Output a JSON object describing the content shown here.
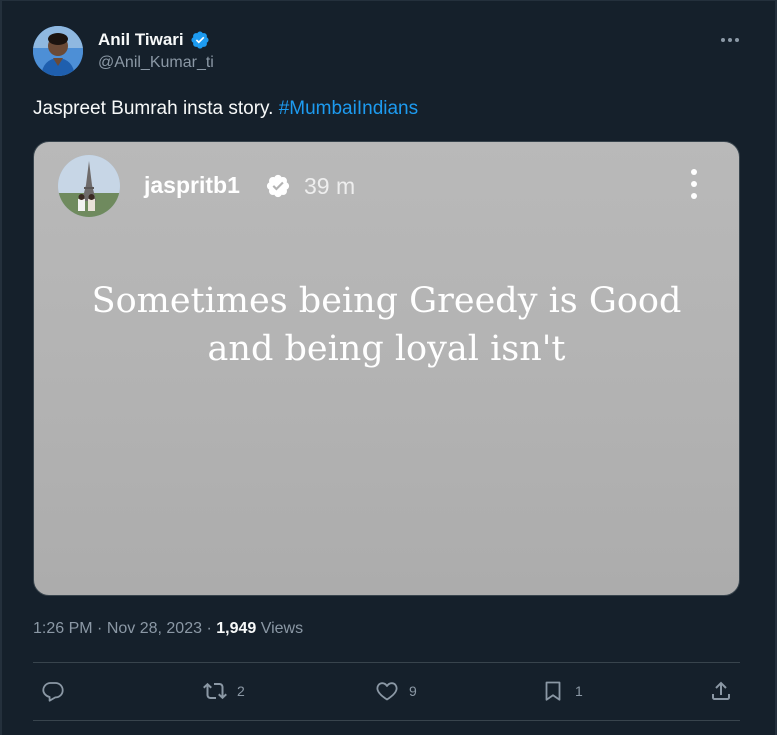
{
  "tweet": {
    "author_name": "Anil Tiwari",
    "author_handle": "@Anil_Kumar_ti",
    "text": "Jaspreet Bumrah insta story. ",
    "hashtag": "#MumbaiIndians",
    "time": "1:26 PM",
    "separator": " · ",
    "date": "Nov 28, 2023",
    "views_count": "1,949",
    "views_label": " Views"
  },
  "story": {
    "username": "jaspritb1",
    "time_ago": "39 m",
    "quote_line1": "Sometimes being Greedy is Good",
    "quote_line2": "and being loyal isn't"
  },
  "actions": {
    "replies": "",
    "retweets": "2",
    "likes": "9",
    "bookmarks": "1"
  },
  "icons": {
    "verified": "verified-badge-icon",
    "more": "more-dots-icon",
    "reply": "reply-bubble-icon",
    "retweet": "retweet-icon",
    "like": "heart-icon",
    "bookmark": "bookmark-icon",
    "share": "share-upload-icon"
  },
  "colors": {
    "background": "#15202b",
    "accent": "#1d9bf0",
    "muted": "#8b98a5",
    "text": "#f7f9f9"
  }
}
